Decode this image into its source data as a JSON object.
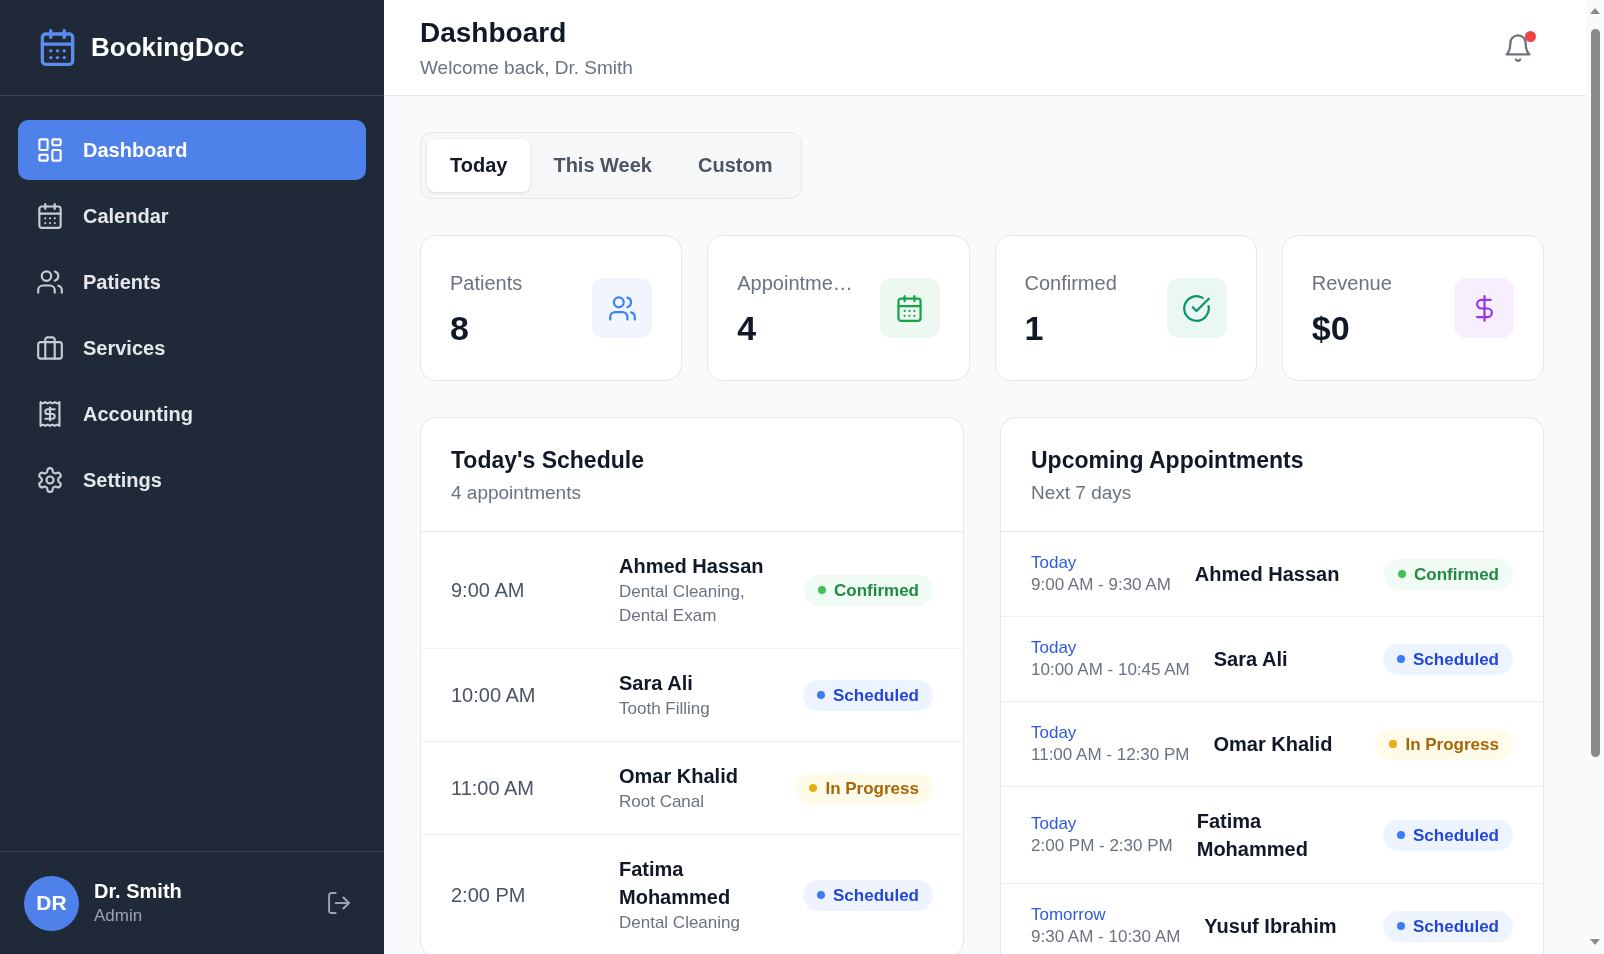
{
  "sidebar": {
    "brand": "BookingDoc",
    "nav_items": [
      {
        "label": "Dashboard",
        "selected": true
      },
      {
        "label": "Calendar",
        "selected": false
      },
      {
        "label": "Patients",
        "selected": false
      },
      {
        "label": "Services",
        "selected": false
      },
      {
        "label": "Accounting",
        "selected": false
      },
      {
        "label": "Settings",
        "selected": false
      }
    ],
    "user": {
      "initials": "DR",
      "name": "Dr. Smith",
      "role": "Admin"
    }
  },
  "header": {
    "title": "Dashboard",
    "subtitle": "Welcome back, Dr. Smith",
    "unread_notifications": true
  },
  "period_tabs": [
    {
      "label": "Today",
      "selected": true
    },
    {
      "label": "This Week",
      "selected": false
    },
    {
      "label": "Custom",
      "selected": false
    }
  ],
  "stats": [
    {
      "label": "Patients",
      "value": "8",
      "color": "#3b82f6"
    },
    {
      "label": "Appointme…",
      "value": "4",
      "color": "#16a34a"
    },
    {
      "label": "Confirmed",
      "value": "1",
      "color": "#059669"
    },
    {
      "label": "Revenue",
      "value": "$0",
      "color": "#9333ea"
    }
  ],
  "todays_schedule": {
    "title": "Today's Schedule",
    "subtitle": "4 appointments",
    "rows": [
      {
        "time": "9:00 AM",
        "patient": "Ahmed Hassan",
        "services": "Dental Cleaning, Dental Exam",
        "status": {
          "label": "Confirmed",
          "kind": "confirmed"
        }
      },
      {
        "time": "10:00 AM",
        "patient": "Sara Ali",
        "services": "Tooth Filling",
        "status": {
          "label": "Scheduled",
          "kind": "scheduled"
        }
      },
      {
        "time": "11:00 AM",
        "patient": "Omar Khalid",
        "services": "Root Canal",
        "status": {
          "label": "In Progress",
          "kind": "in_progress"
        }
      },
      {
        "time": "2:00 PM",
        "patient": "Fatima Mohammed",
        "services": "Dental Cleaning",
        "status": {
          "label": "Scheduled",
          "kind": "scheduled"
        }
      }
    ]
  },
  "upcoming_appointments": {
    "title": "Upcoming Appointments",
    "subtitle": "Next 7 days",
    "rows": [
      {
        "day": "Today",
        "time_range": "9:00 AM - 9:30 AM",
        "patient": "Ahmed Hassan",
        "status": {
          "label": "Confirmed",
          "kind": "confirmed"
        }
      },
      {
        "day": "Today",
        "time_range": "10:00 AM - 10:45 AM",
        "patient": "Sara Ali",
        "status": {
          "label": "Scheduled",
          "kind": "scheduled"
        }
      },
      {
        "day": "Today",
        "time_range": "11:00 AM - 12:30 PM",
        "patient": "Omar Khalid",
        "status": {
          "label": "In Progress",
          "kind": "in_progress"
        }
      },
      {
        "day": "Today",
        "time_range": "2:00 PM - 2:30 PM",
        "patient": "Fatima Mohammed",
        "status": {
          "label": "Scheduled",
          "kind": "scheduled"
        }
      },
      {
        "day": "Tomorrow",
        "time_range": "9:30 AM - 10:30 AM",
        "patient": "Yusuf Ibrahim",
        "status": {
          "label": "Scheduled",
          "kind": "scheduled"
        }
      }
    ]
  }
}
